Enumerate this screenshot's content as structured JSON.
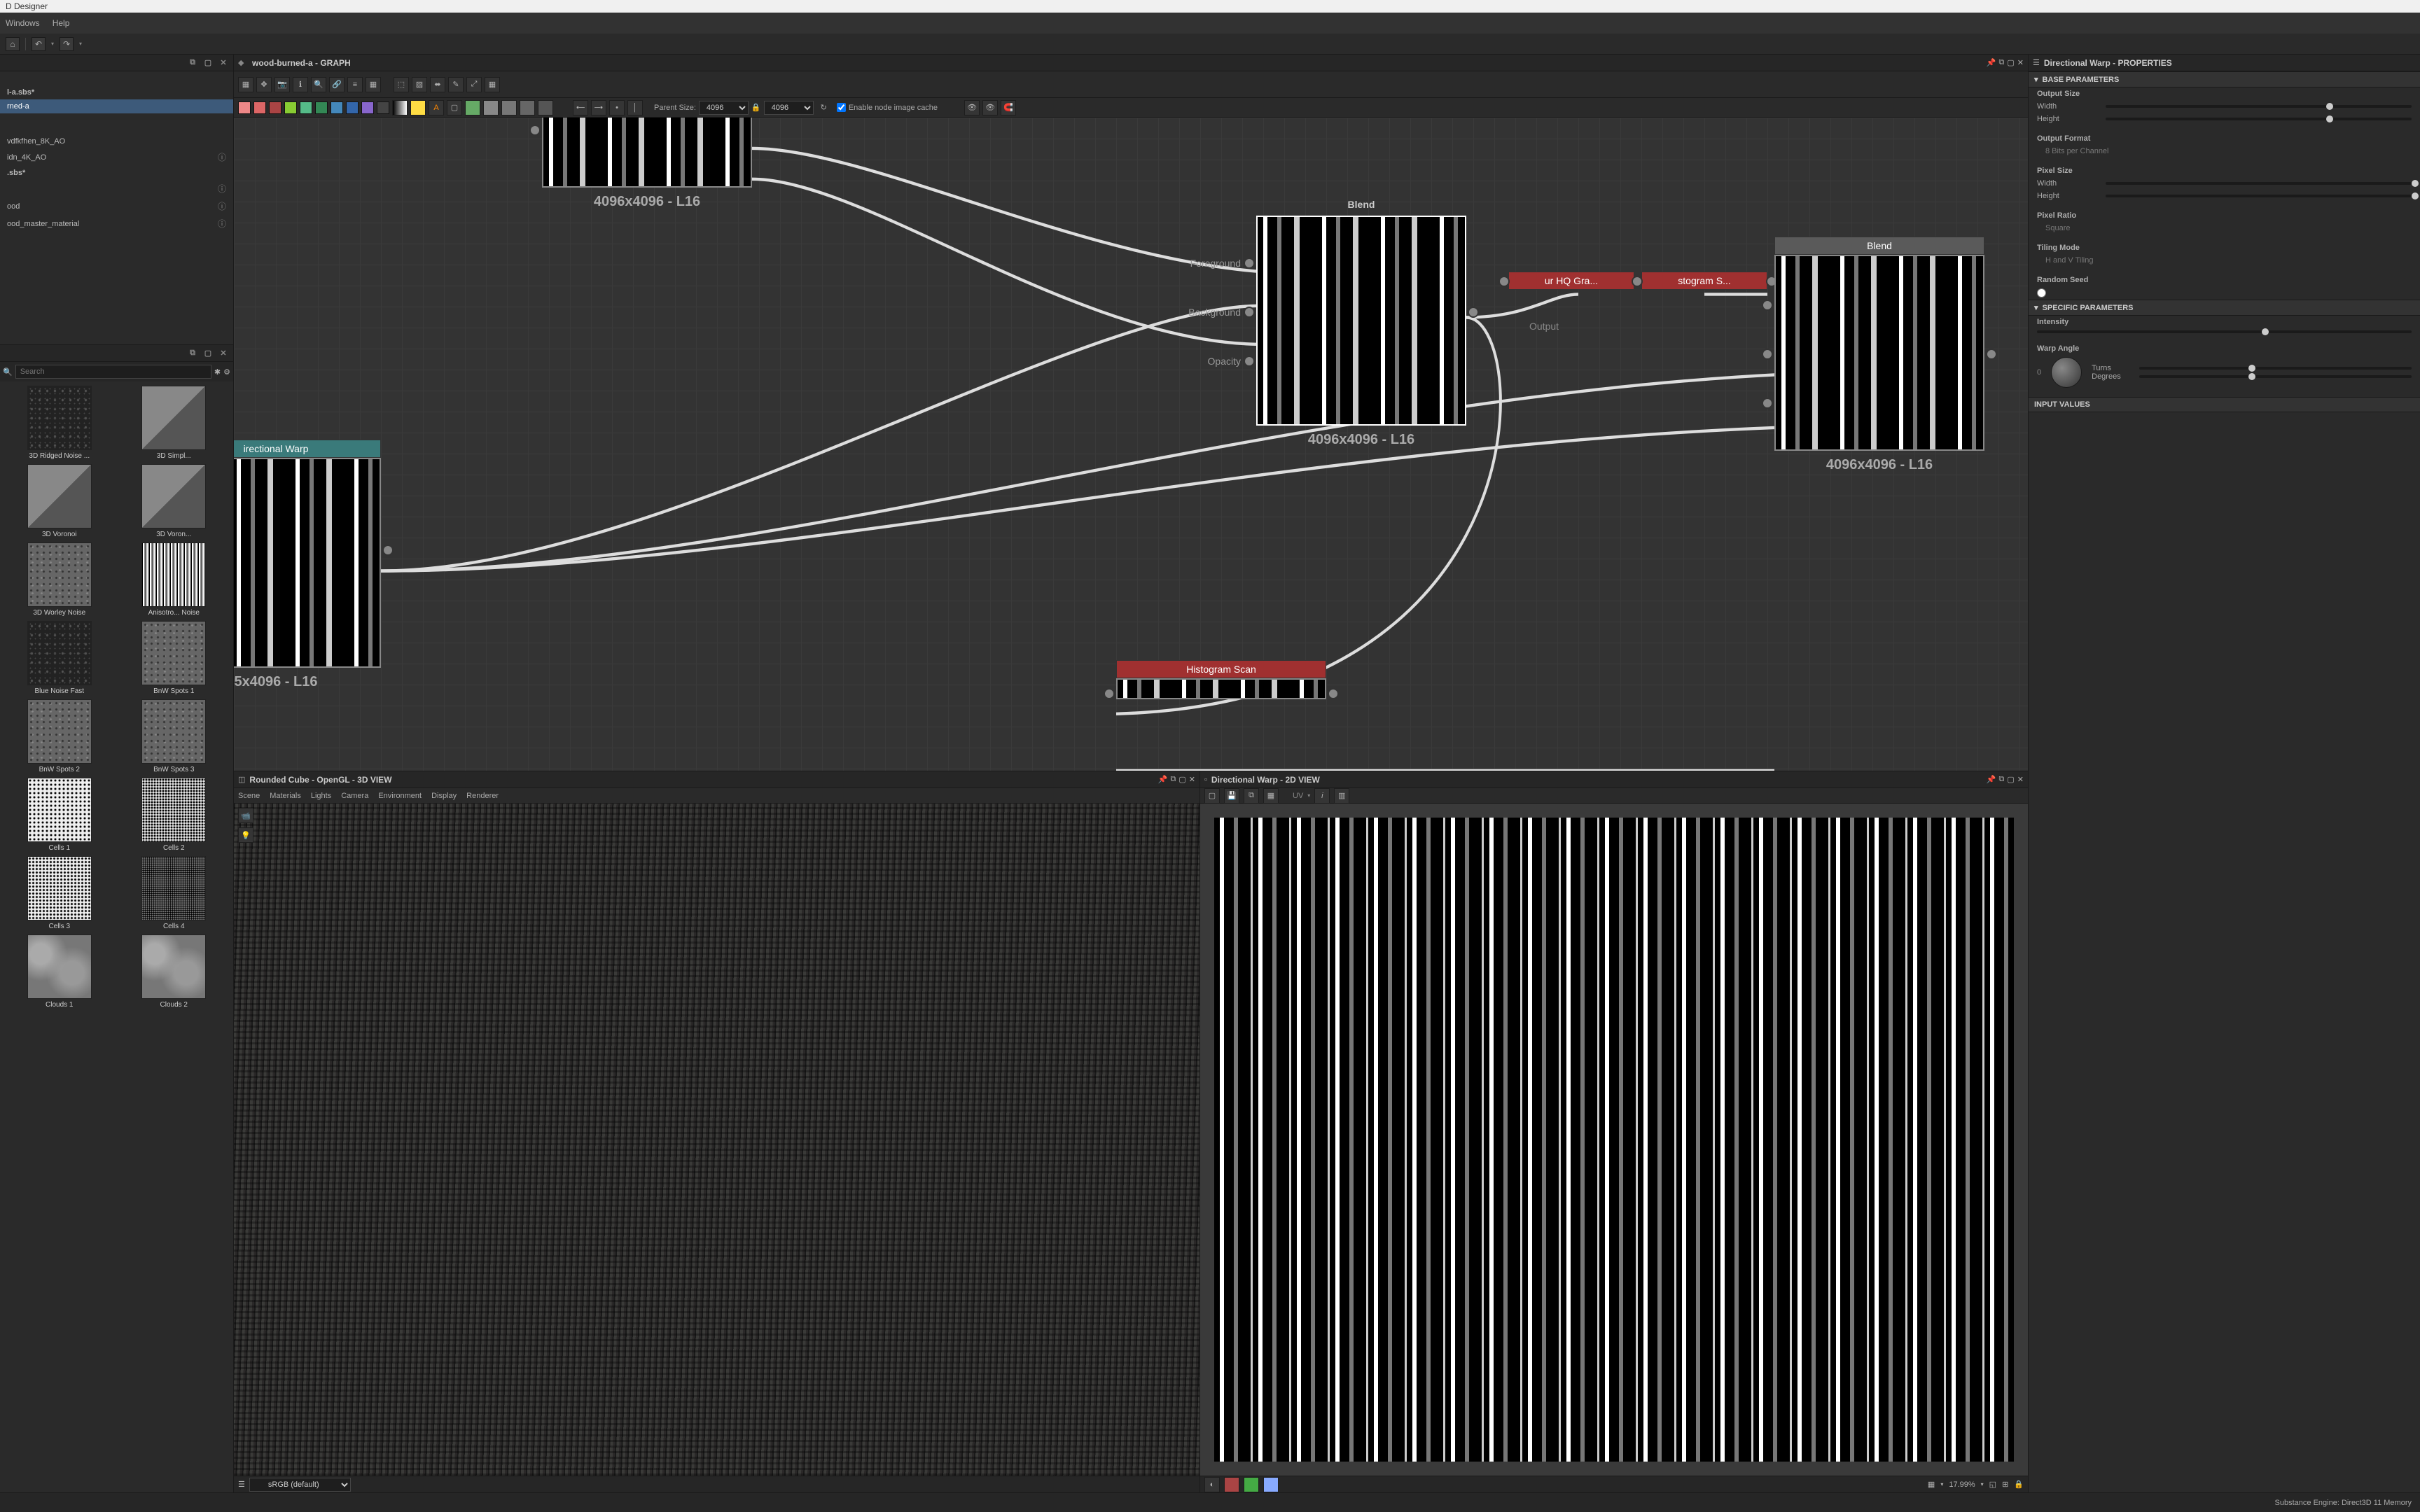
{
  "app": {
    "title": "D Designer"
  },
  "menubar": {
    "windows": "Windows",
    "help": "Help"
  },
  "graph": {
    "title": "wood-burned-a - GRAPH",
    "parent_size_label": "Parent Size:",
    "parent_w": "4096",
    "parent_h": "4096",
    "cache_label": "Enable node image cache"
  },
  "explorer": {
    "filter_placeholder": "",
    "root": "l-a.sbs*",
    "sel": "rned-a",
    "items": [
      "vdfkfhen_8K_AO",
      "idn_4K_AO",
      ".sbs*",
      "ood",
      "ood_master_material"
    ]
  },
  "library": {
    "search_placeholder": "Search",
    "items": [
      "3D Ridged Noise ...",
      "3D Simpl...",
      "3D Voronoi",
      "3D Voron...",
      "3D Worley Noise",
      "Anisotro... Noise",
      "Blue Noise Fast",
      "BnW Spots 1",
      "BnW Spots 2",
      "BnW Spots 3",
      "Cells 1",
      "Cells 2",
      "Cells 3",
      "Cells 4",
      "Clouds 1",
      "Clouds 2"
    ]
  },
  "nodes": {
    "top_caption": "4096x4096 - L16",
    "dirwarp_title": "irectional Warp",
    "dirwarp_caption": "5x4096 - L16",
    "blend1_title": "Blend",
    "blend1_caption": "4096x4096 - L16",
    "blend1_port_fg": "Foreground",
    "blend1_port_bg": "Background",
    "blend1_port_op": "Opacity",
    "blur_label": "ur HQ Gra...",
    "histo_label": "stogram S...",
    "output_label": "Output",
    "blend2_title": "Blend",
    "blend2_caption": "4096x4096 - L16",
    "histoscan_title": "Histogram Scan"
  },
  "view3d": {
    "title": "Rounded Cube - OpenGL - 3D VIEW",
    "menus": [
      "Scene",
      "Materials",
      "Lights",
      "Camera",
      "Environment",
      "Display",
      "Renderer"
    ],
    "srgb": "sRGB (default)"
  },
  "view2d": {
    "title": "Directional Warp - 2D VIEW",
    "uv_label": "UV",
    "zoom": "17.99%"
  },
  "properties": {
    "title": "Directional Warp - PROPERTIES",
    "base_header": "BASE PARAMETERS",
    "output_size": "Output Size",
    "width": "Width",
    "height": "Height",
    "output_format": "Output Format",
    "output_format_val": "8 Bits per Channel",
    "pixel_size": "Pixel Size",
    "pixel_ratio": "Pixel Ratio",
    "pixel_ratio_val": "Square",
    "tiling_mode": "Tiling Mode",
    "tiling_mode_val": "H and V Tiling",
    "random_seed": "Random Seed",
    "specific_header": "SPECIFIC PARAMETERS",
    "intensity": "Intensity",
    "warp_angle": "Warp Angle",
    "turns": "Turns",
    "degrees": "Degrees",
    "angle_zero": "0",
    "input_values": "INPUT VALUES"
  },
  "statusbar": {
    "engine": "Substance Engine: Direct3D 11  Memory"
  }
}
